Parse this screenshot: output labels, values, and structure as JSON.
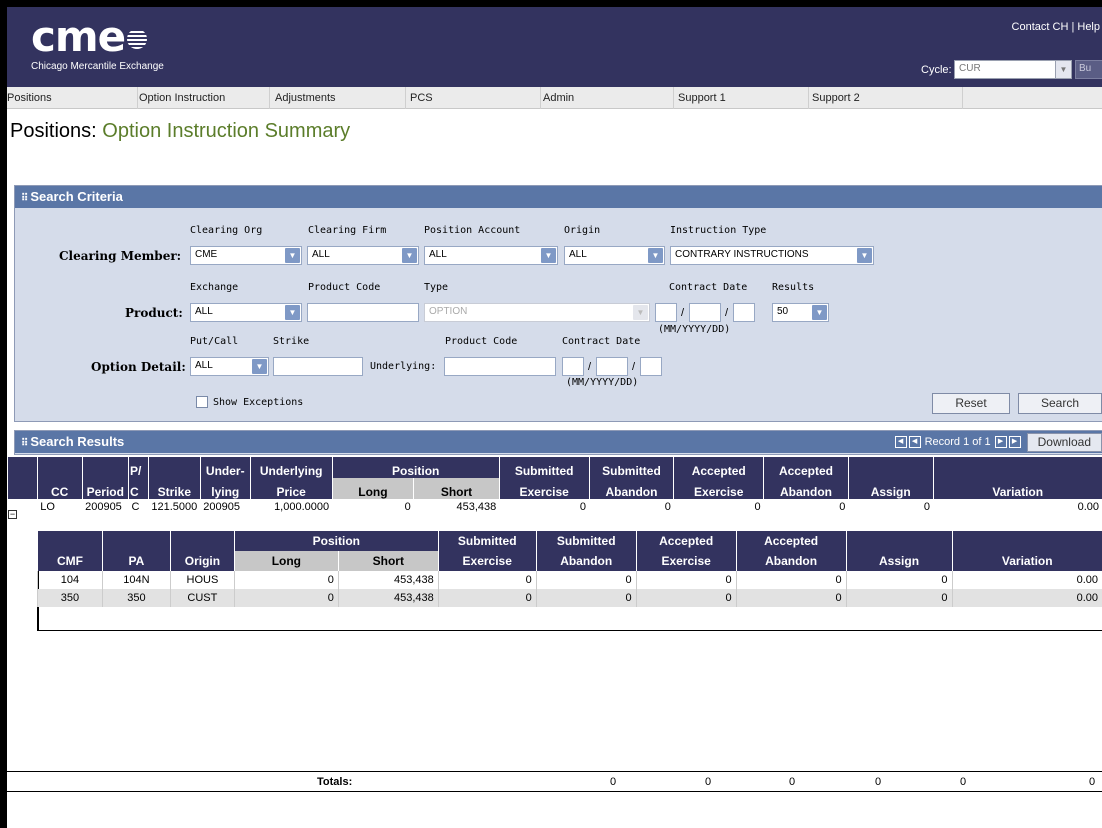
{
  "header": {
    "logo_text": "cme",
    "logo_sub": "Chicago Mercantile Exchange",
    "contact": "Contact CH",
    "sep": "|",
    "help": "Help",
    "cycle_label": "Cycle:",
    "cycle_value": "CUR",
    "cycle_btn": "Bu"
  },
  "nav": [
    "Positions",
    "Option Instruction",
    "Adjustments",
    "PCS",
    "Admin",
    "Support 1",
    "Support 2"
  ],
  "page_title": {
    "section": "Positions:",
    "name": "Option Instruction Summary"
  },
  "search": {
    "title": "Search Criteria",
    "row1": {
      "label": "Clearing Member:",
      "clearing_org_label": "Clearing Org",
      "clearing_org": "CME",
      "clearing_firm_label": "Clearing Firm",
      "clearing_firm": "ALL",
      "position_account_label": "Position Account",
      "position_account": "ALL",
      "origin_label": "Origin",
      "origin": "ALL",
      "instruction_type_label": "Instruction Type",
      "instruction_type": "CONTRARY INSTRUCTIONS"
    },
    "row2": {
      "label": "Product:",
      "exchange_label": "Exchange",
      "exchange": "ALL",
      "product_code_label": "Product Code",
      "product_code": "",
      "type_label": "Type",
      "type": "OPTION",
      "contract_date_label": "Contract Date",
      "date_format": "(MM/YYYY/DD)",
      "results_label": "Results",
      "results": "50"
    },
    "row3": {
      "label": "Option Detail:",
      "put_call_label": "Put/Call",
      "put_call": "ALL",
      "strike_label": "Strike",
      "underlying_label": "Underlying:",
      "product_code_label": "Product Code",
      "contract_date_label": "Contract Date",
      "date_format": "(MM/YYYY/DD)"
    },
    "show_exceptions": "Show Exceptions",
    "reset": "Reset",
    "search_btn": "Search"
  },
  "results": {
    "title": "Search Results",
    "record_info": "Record 1 of 1",
    "download": "Download",
    "columns": {
      "cc": "CC",
      "period": "Period",
      "pc1": "P/",
      "pc2": "C",
      "strike": "Strike",
      "underlying1": "Under-",
      "underlying2": "lying",
      "uprice1": "Underlying",
      "uprice2": "Price",
      "position": "Position",
      "long": "Long",
      "short": "Short",
      "se1": "Submitted",
      "se2": "Exercise",
      "sa1": "Submitted",
      "sa2": "Abandon",
      "ae1": "Accepted",
      "ae2": "Exercise",
      "aa1": "Accepted",
      "aa2": "Abandon",
      "assign": "Assign",
      "variation": "Variation"
    },
    "row": {
      "cc": "LO",
      "period": "200905",
      "pc": "C",
      "strike": "121.5000",
      "underlying": "200905",
      "underlying_price": "1,000.0000",
      "long": "0",
      "short": "453,438",
      "sub_exercise": "0",
      "sub_abandon": "0",
      "acc_exercise": "0",
      "acc_abandon": "0",
      "assign": "0",
      "variation": "0.00"
    },
    "detail_columns": {
      "cmf": "CMF",
      "pa": "PA",
      "origin": "Origin",
      "position": "Position",
      "long": "Long",
      "short": "Short",
      "se1": "Submitted",
      "se2": "Exercise",
      "sa1": "Submitted",
      "sa2": "Abandon",
      "ae1": "Accepted",
      "ae2": "Exercise",
      "aa1": "Accepted",
      "aa2": "Abandon",
      "assign": "Assign",
      "variation": "Variation"
    },
    "detail_rows": [
      {
        "cmf": "104",
        "pa": "104N",
        "origin": "HOUS",
        "long": "0",
        "short": "453,438",
        "se": "0",
        "sa": "0",
        "ae": "0",
        "aa": "0",
        "assign": "0",
        "variation": "0.00"
      },
      {
        "cmf": "350",
        "pa": "350",
        "origin": "CUST",
        "long": "0",
        "short": "453,438",
        "se": "0",
        "sa": "0",
        "ae": "0",
        "aa": "0",
        "assign": "0",
        "variation": "0.00"
      }
    ],
    "totals": {
      "label": "Totals:",
      "se": "0",
      "sa": "0",
      "ae": "0",
      "aa": "0",
      "assign": "0",
      "variation": "0"
    }
  },
  "colors": {
    "header_bg": "#33335f",
    "panel_head": "#5a76a6",
    "panel_bg": "#d5dcea",
    "title_accent": "#5b7d2a"
  }
}
